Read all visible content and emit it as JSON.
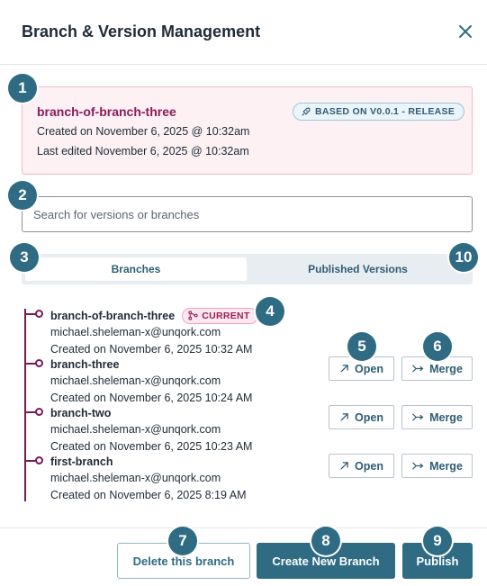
{
  "dialog": {
    "title": "Branch & Version Management"
  },
  "current_branch": {
    "name": "branch-of-branch-three",
    "based_on": "BASED ON V0.0.1 - RELEASE",
    "created": "Created on November 6, 2025 @ 10:32am",
    "last_edited": "Last edited November 6, 2025 @ 10:32am"
  },
  "search": {
    "placeholder": "Search for versions or branches",
    "value": ""
  },
  "tabs": [
    {
      "label": "Branches",
      "active": true
    },
    {
      "label": "Published Versions",
      "active": false
    }
  ],
  "branches": [
    {
      "name": "branch-of-branch-three",
      "current_label": "CURRENT",
      "user": "michael.sheleman-x@unqork.com",
      "created": "Created on November 6, 2025 10:32 AM"
    },
    {
      "name": "branch-three",
      "user": "michael.sheleman-x@unqork.com",
      "created": "Created on November 6, 2025 10:24 AM"
    },
    {
      "name": "branch-two",
      "user": "michael.sheleman-x@unqork.com",
      "created": "Created on November 6, 2025 10:23 AM"
    },
    {
      "name": "first-branch",
      "user": "michael.sheleman-x@unqork.com",
      "created": "Created on November 6, 2025 8:19 AM"
    }
  ],
  "row_actions": {
    "open_label": "Open",
    "merge_label": "Merge"
  },
  "footer": {
    "delete_label": "Delete this branch",
    "create_label": "Create New Branch",
    "publish_label": "Publish"
  },
  "callouts": [
    "1",
    "2",
    "3",
    "4",
    "5",
    "6",
    "7",
    "8",
    "9",
    "10"
  ],
  "colors": {
    "primary": "#2f6c83",
    "branch_accent": "#7a1a52",
    "info_bg": "#fdf1f3",
    "current_pill_bg": "#fde8ef"
  }
}
